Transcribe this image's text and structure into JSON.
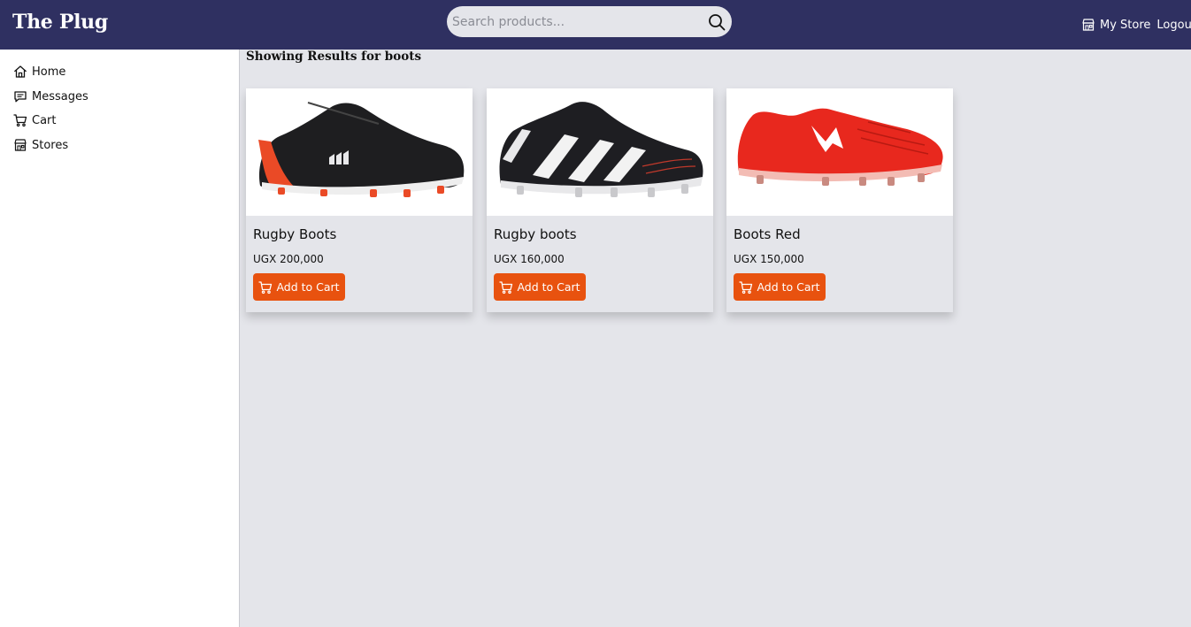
{
  "header": {
    "brand": "The Plug",
    "search_placeholder": "Search products...",
    "my_store_label": "My Store",
    "logout_label": "Logout"
  },
  "sidebar": {
    "items": [
      {
        "label": "Home",
        "icon": "home-icon"
      },
      {
        "label": "Messages",
        "icon": "message-icon"
      },
      {
        "label": "Cart",
        "icon": "cart-icon"
      },
      {
        "label": "Stores",
        "icon": "store-icon"
      }
    ]
  },
  "main": {
    "heading": "Showing Results for boots",
    "products": [
      {
        "name": "Rugby Boots",
        "price": "UGX 200,000",
        "button": "Add to Cart",
        "image": "black-orange-rugby-boot"
      },
      {
        "name": "Rugby boots",
        "price": "UGX 160,000",
        "button": "Add to Cart",
        "image": "black-white-striped-rugby-boot"
      },
      {
        "name": "Boots Red",
        "price": "UGX 150,000",
        "button": "Add to Cart",
        "image": "red-rugby-boot"
      }
    ]
  },
  "colors": {
    "header_bg": "#2f3061",
    "main_bg": "#e4e5ea",
    "accent": "#e8520f"
  }
}
